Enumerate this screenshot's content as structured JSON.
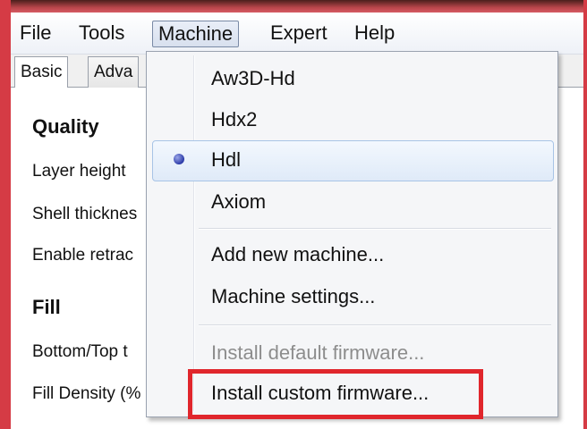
{
  "menubar": {
    "items": [
      "File",
      "Tools",
      "Machine",
      "Expert",
      "Help"
    ],
    "active": "Machine"
  },
  "tabs": [
    "Basic",
    "Adva"
  ],
  "panel": {
    "sections": [
      {
        "title": "Quality",
        "fields": [
          "Layer height",
          "Shell thicknes",
          "Enable retrac"
        ]
      },
      {
        "title": "Fill",
        "fields": [
          "Bottom/Top t",
          "Fill Density (%"
        ]
      }
    ]
  },
  "machine_menu": {
    "machines": [
      "Aw3D-Hd",
      "Hdx2",
      "Hdl",
      "Axiom"
    ],
    "selected_machine": "Hdl",
    "actions": [
      "Add new machine...",
      "Machine settings..."
    ],
    "firmware": [
      {
        "label": "Install default firmware...",
        "enabled": false
      },
      {
        "label": "Install custom firmware...",
        "enabled": true
      }
    ]
  },
  "colors": {
    "frame_red": "#d53b45",
    "highlight_red": "#e0262c",
    "radio_blue": "#2b3aa8"
  }
}
